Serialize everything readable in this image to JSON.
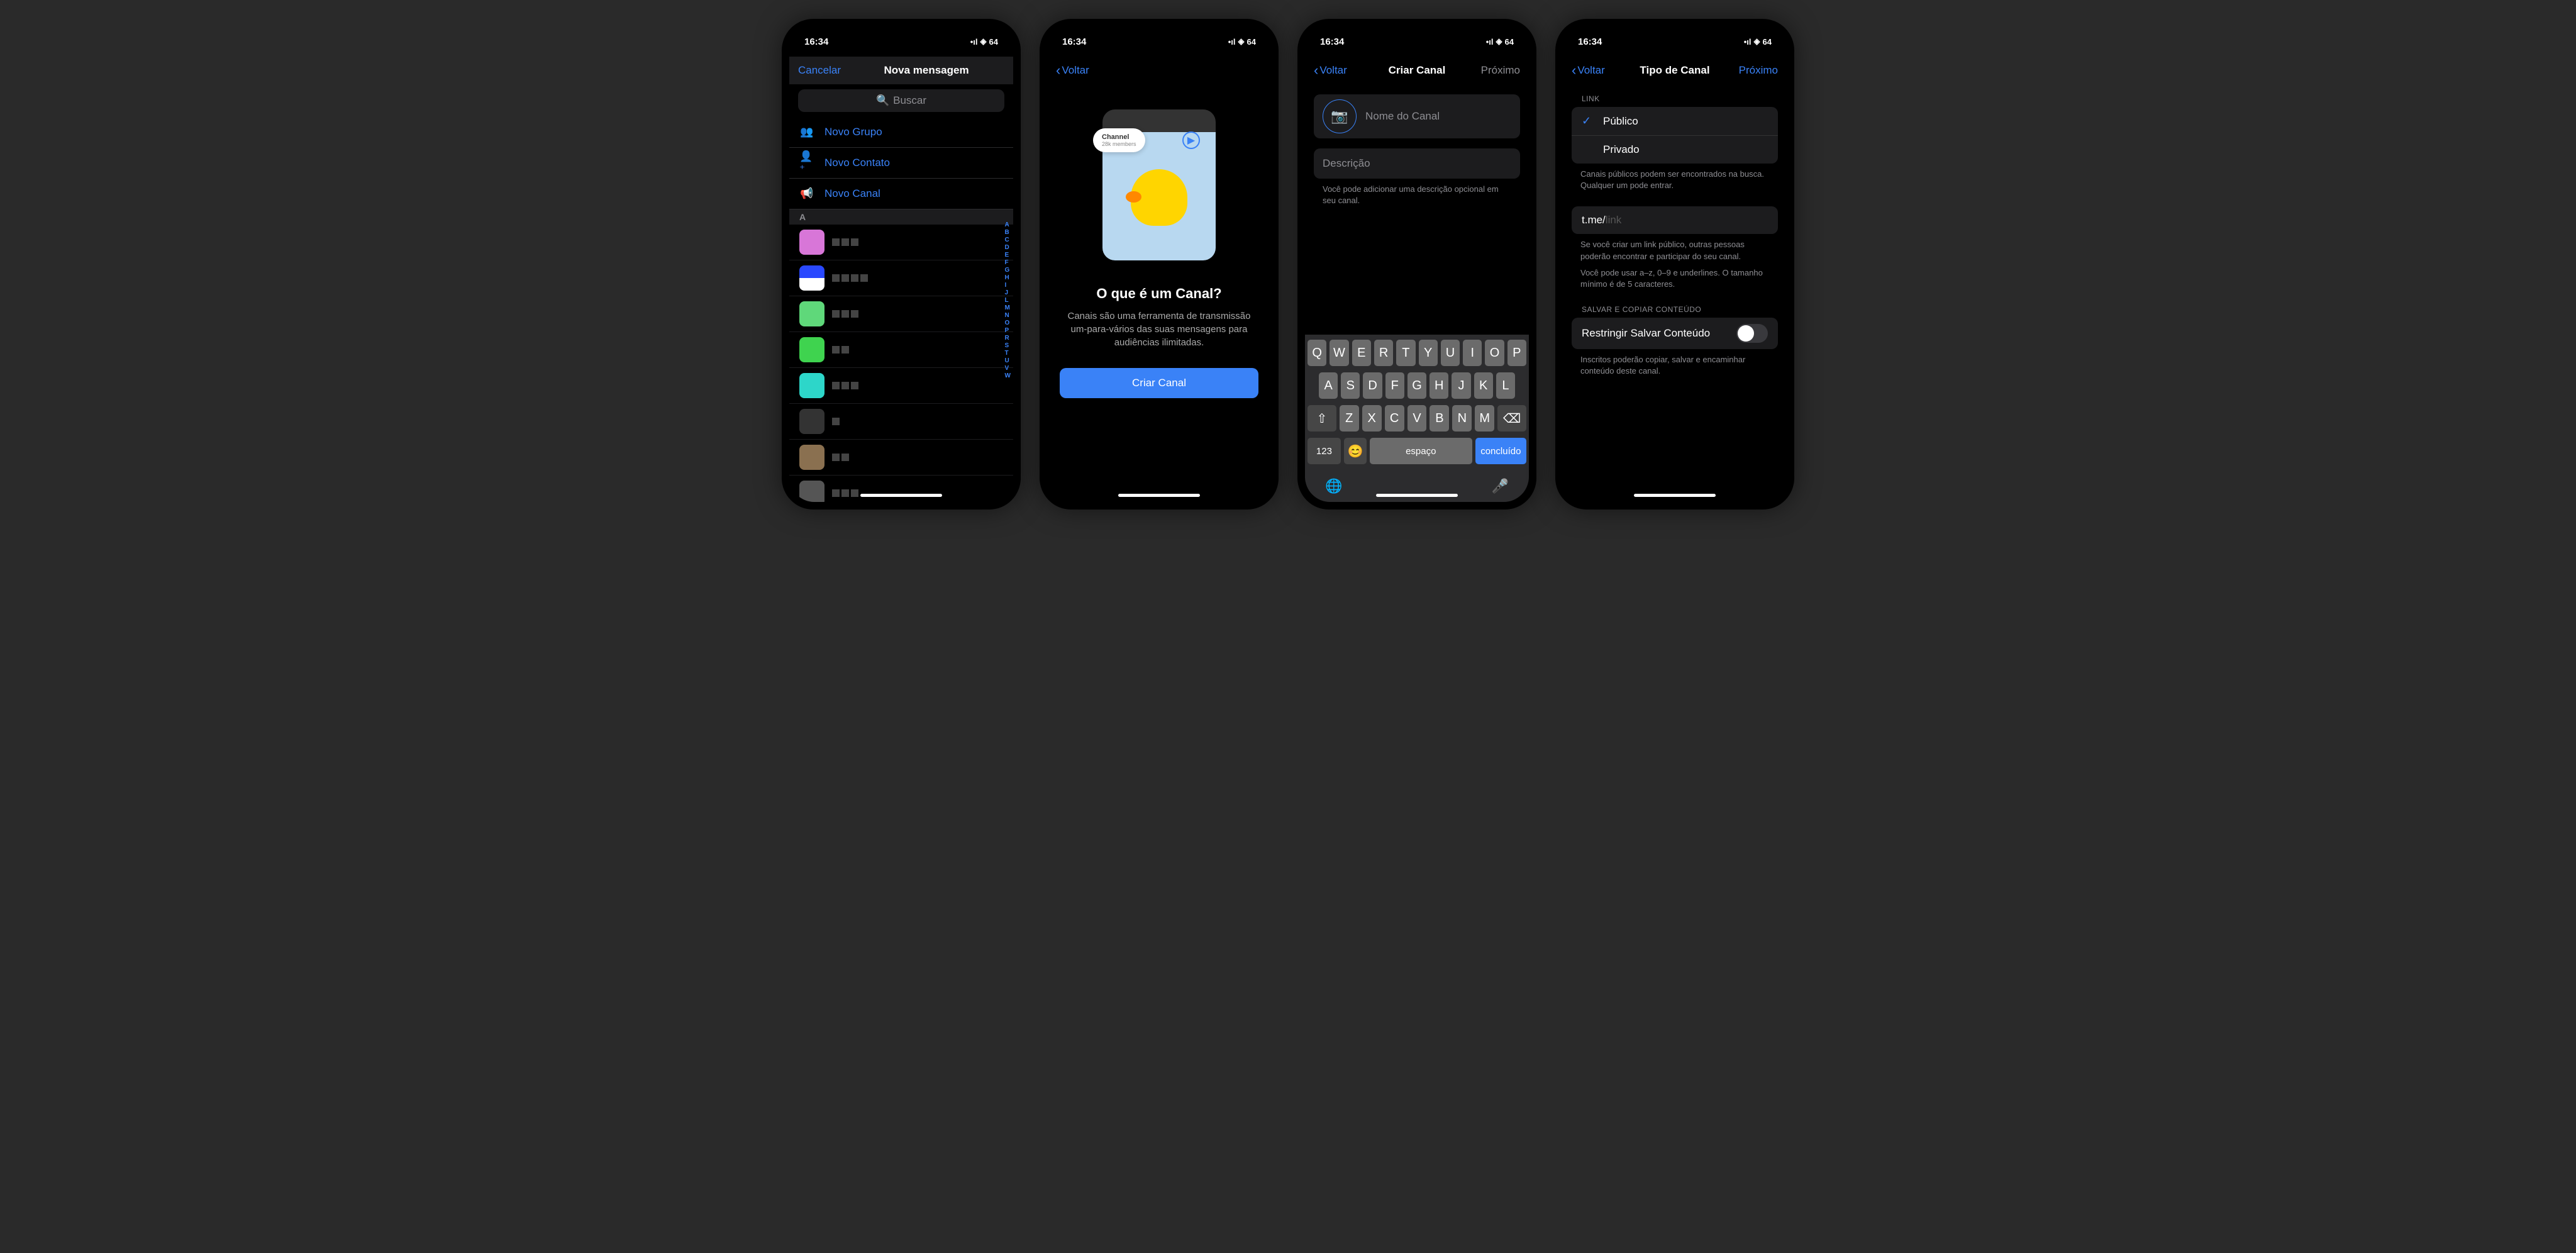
{
  "status": {
    "time": "16:34",
    "battery": "64"
  },
  "screen1": {
    "cancel": "Cancelar",
    "title": "Nova mensagem",
    "search": "Buscar",
    "menu": {
      "group": "Novo Grupo",
      "contact": "Novo Contato",
      "channel": "Novo Canal"
    },
    "section": "A",
    "alpha": [
      "A",
      "B",
      "C",
      "D",
      "E",
      "F",
      "G",
      "H",
      "I",
      "J",
      "L",
      "M",
      "N",
      "O",
      "P",
      "R",
      "S",
      "T",
      "U",
      "V",
      "W"
    ]
  },
  "screen2": {
    "back": "Voltar",
    "badge_title": "Channel",
    "badge_sub": "28k members",
    "title": "O que é um Canal?",
    "desc": "Canais são uma ferramenta de transmissão um-para-vários das suas mensagens para audiências ilimitadas.",
    "button": "Criar Canal"
  },
  "screen3": {
    "back": "Voltar",
    "title": "Criar Canal",
    "next": "Próximo",
    "name_placeholder": "Nome do Canal",
    "desc_placeholder": "Descrição",
    "desc_help": "Você pode adicionar uma descrição opcional em seu canal.",
    "keyboard": {
      "row1": [
        "Q",
        "W",
        "E",
        "R",
        "T",
        "Y",
        "U",
        "I",
        "O",
        "P"
      ],
      "row2": [
        "A",
        "S",
        "D",
        "F",
        "G",
        "H",
        "J",
        "K",
        "L"
      ],
      "row3": [
        "Z",
        "X",
        "C",
        "V",
        "B",
        "N",
        "M"
      ],
      "num": "123",
      "space": "espaço",
      "done": "concluído"
    }
  },
  "screen4": {
    "back": "Voltar",
    "title": "Tipo de Canal",
    "next": "Próximo",
    "link_label": "LINK",
    "public": "Público",
    "private": "Privado",
    "link_help": "Canais públicos podem ser encontrados na busca. Qualquer um pode entrar.",
    "link_prefix": "t.me/",
    "link_placeholder": "link",
    "link_help2": "Se você criar um link público, outras pessoas poderão encontrar e participar do seu canal.",
    "link_help3": "Você pode usar a–z, 0–9 e underlines. O tamanho mínimo é de 5 caracteres.",
    "save_label": "SALVAR E COPIAR CONTEÚDO",
    "restrict": "Restringir Salvar Conteúdo",
    "restrict_help": "Inscritos poderão copiar, salvar e encaminhar conteúdo deste canal."
  }
}
